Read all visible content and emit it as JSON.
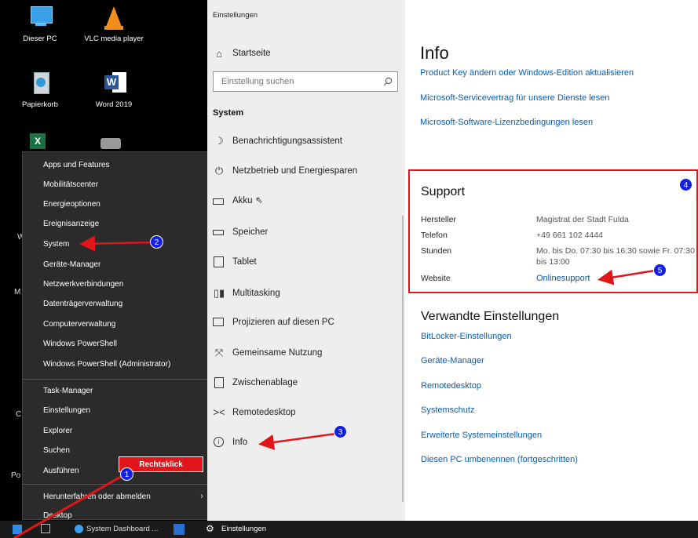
{
  "desktop": {
    "icons": [
      {
        "label": "Dieser PC",
        "icon": "computer-icon"
      },
      {
        "label": "VLC media player",
        "icon": "vlc-cone-icon"
      },
      {
        "label": "Papierkorb",
        "icon": "recycle-bin-icon"
      },
      {
        "label": "Word 2019",
        "icon": "word-icon"
      }
    ]
  },
  "context_menu": {
    "items_group1": [
      "Apps und Features",
      "Mobilitätscenter",
      "Energieoptionen",
      "Ereignisanzeige",
      "System",
      "Geräte-Manager",
      "Netzwerkverbindungen",
      "Datenträgerverwaltung",
      "Computerverwaltung",
      "Windows PowerShell",
      "Windows PowerShell (Administrator)"
    ],
    "items_group2": [
      "Task-Manager",
      "Einstellungen",
      "Explorer",
      "Suchen",
      "Ausführen"
    ],
    "shutdown": "Herunterfahren oder abmelden",
    "desktop": "Desktop"
  },
  "settings_nav": {
    "window_title": "Einstellungen",
    "home": "Startseite",
    "search_placeholder": "Einstellung suchen",
    "section": "System",
    "items": [
      {
        "label": "Benachrichtigungsassistent",
        "icon": "moon-icon"
      },
      {
        "label": "Netzbetrieb und Energiesparen",
        "icon": "power-icon"
      },
      {
        "label": "Akku",
        "icon": "battery-icon"
      },
      {
        "label": "Speicher",
        "icon": "storage-icon"
      },
      {
        "label": "Tablet",
        "icon": "tablet-icon"
      },
      {
        "label": "Multitasking",
        "icon": "multitasking-icon"
      },
      {
        "label": "Projizieren auf diesen PC",
        "icon": "project-icon"
      },
      {
        "label": "Gemeinsame Nutzung",
        "icon": "share-icon"
      },
      {
        "label": "Zwischenablage",
        "icon": "clipboard-icon"
      },
      {
        "label": "Remotedesktop",
        "icon": "remote-icon"
      },
      {
        "label": "Info",
        "icon": "info-icon"
      }
    ]
  },
  "content": {
    "title": "Info",
    "top_links": [
      "Product Key ändern oder Windows-Edition aktualisieren",
      "Microsoft-Servicevertrag für unsere Dienste lesen",
      "Microsoft-Software-Lizenzbedingungen lesen"
    ],
    "support": {
      "title": "Support",
      "hersteller_label": "Hersteller",
      "hersteller_value": "Magistrat der Stadt Fulda",
      "telefon_label": "Telefon",
      "telefon_value": "+49 661 102 4444",
      "stunden_label": "Stunden",
      "stunden_line1": "Mo. bis Do. 07:30 bis 16:30 sowie Fr. 07:30",
      "stunden_line2": "bis 13:00",
      "website_label": "Website",
      "website_link": "Onlinesupport"
    },
    "related": {
      "title": "Verwandte Einstellungen",
      "links": [
        "BitLocker-Einstellungen",
        "Geräte-Manager",
        "Remotedesktop",
        "Systemschutz",
        "Erweiterte Systemeinstellungen",
        "Diesen PC umbenennen (fortgeschritten)"
      ]
    }
  },
  "taskbar": {
    "item1": "System Dashboard ...",
    "item2": "Einstellungen"
  },
  "annotations": {
    "rechtsklick_label": "Rechtsklick",
    "badges": [
      "1",
      "2",
      "3",
      "4",
      "5"
    ],
    "accent": "#e0161b",
    "badge_color": "#1220e6"
  }
}
